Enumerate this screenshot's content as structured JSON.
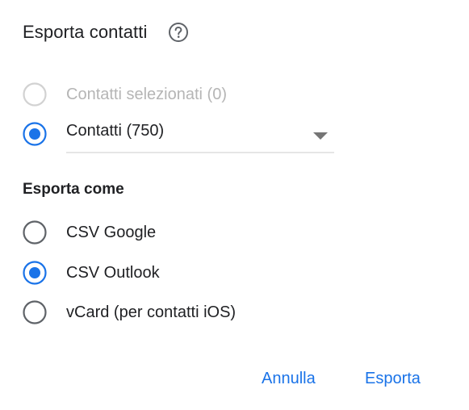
{
  "dialog": {
    "title": "Esporta contatti",
    "help_icon": "help-circle-icon"
  },
  "source": {
    "options": [
      {
        "label": "Contatti selezionati (0)",
        "selected": false,
        "disabled": true
      },
      {
        "label": "Contatti (750)",
        "selected": true,
        "disabled": false
      }
    ],
    "select_value": "Contatti (750)"
  },
  "format": {
    "heading": "Esporta come",
    "options": [
      {
        "label": "CSV Google",
        "selected": false
      },
      {
        "label": "CSV Outlook",
        "selected": true
      },
      {
        "label": "vCard (per contatti iOS)",
        "selected": false
      }
    ]
  },
  "actions": {
    "cancel_label": "Annulla",
    "export_label": "Esporta"
  },
  "colors": {
    "accent": "#1a73e8",
    "radio_unselected": "#5f6368",
    "disabled": "#c4c4c4"
  }
}
